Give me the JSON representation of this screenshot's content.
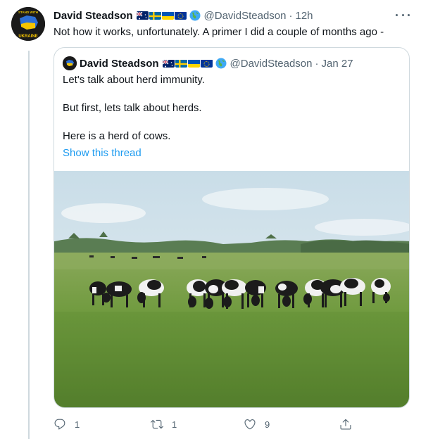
{
  "tweet": {
    "author_name": "David Steadson",
    "handle": "@DavidSteadson",
    "separator": "·",
    "time": "12h",
    "text": "Not how it works, unfortunately. A primer I did a couple of months ago -",
    "avatar_label_top": "STAND WITH",
    "avatar_label_bottom": "UKRAINE",
    "flags": [
      "australia-flag-icon",
      "sweden-flag-icon",
      "ukraine-flag-icon",
      "eu-flag-icon",
      "globe-icon"
    ]
  },
  "quoted": {
    "author_name": "David Steadson",
    "handle": "@DavidSteadson",
    "separator": "·",
    "date": "Jan 27",
    "lines": [
      "Let's talk about herd immunity.",
      "But first, lets talk about herds.",
      "Here is a herd of cows."
    ],
    "show_thread": "Show this thread",
    "image": "herd-of-cows-photo"
  },
  "actions": {
    "reply_count": "1",
    "retweet_count": "1",
    "like_count": "9",
    "share_count": ""
  },
  "colors": {
    "text": "#0f1419",
    "secondary": "#536471",
    "link": "#1d9bf0",
    "border": "#cfd9de"
  }
}
